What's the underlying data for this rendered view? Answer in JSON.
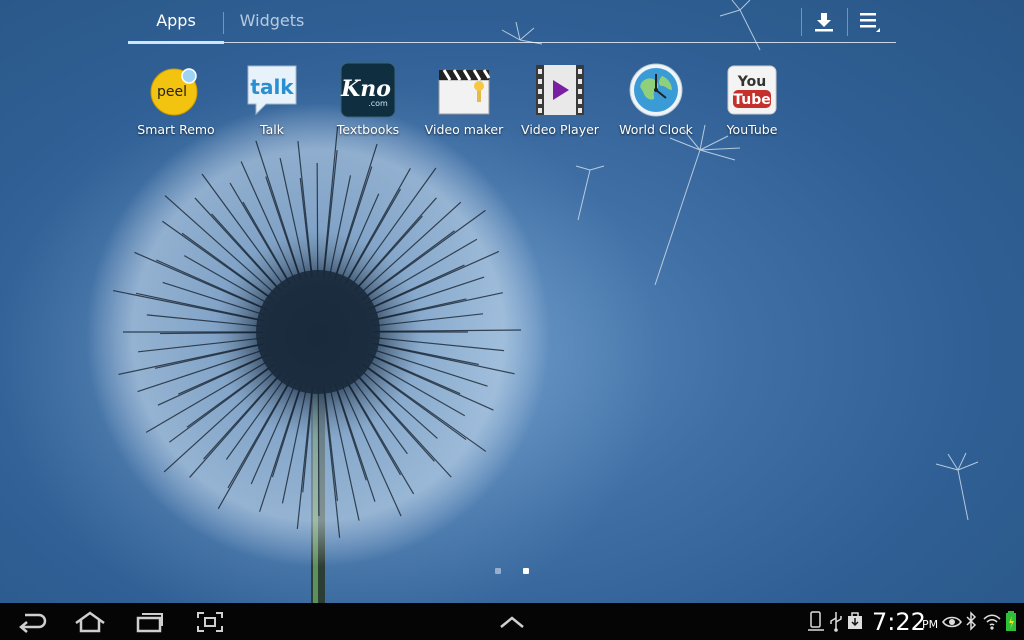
{
  "tabs": [
    {
      "label": "Apps",
      "selected": true
    },
    {
      "label": "Widgets",
      "selected": false
    }
  ],
  "toolbar": {
    "download_icon": "download-icon",
    "menu_icon": "menu-icon"
  },
  "apps": [
    {
      "label": "Smart Remo",
      "icon": "peel-smart-remote-icon"
    },
    {
      "label": "Talk",
      "icon": "talk-icon"
    },
    {
      "label": "Textbooks",
      "icon": "kno-textbooks-icon",
      "icon_text": "Kno",
      "icon_subtext": ".com"
    },
    {
      "label": "Video maker",
      "icon": "video-maker-icon"
    },
    {
      "label": "Video Player",
      "icon": "video-player-icon"
    },
    {
      "label": "World Clock",
      "icon": "world-clock-icon"
    },
    {
      "label": "YouTube",
      "icon": "youtube-icon",
      "icon_text_top": "You",
      "icon_text_bottom": "Tube"
    }
  ],
  "peel_text": "peel",
  "talk_text": "talk",
  "pager": {
    "count": 2,
    "current": 2
  },
  "navbar": {
    "buttons": [
      "back-icon",
      "home-icon",
      "recent-apps-icon",
      "screenshot-icon",
      "up-arrow-icon"
    ]
  },
  "status": {
    "time": "7:22",
    "ampm": "PM",
    "icons": [
      "phone-connected-icon",
      "usb-icon",
      "download-complete-icon",
      "smart-stay-eye-icon",
      "bluetooth-icon",
      "wifi-icon",
      "battery-charging-icon"
    ]
  },
  "colors": {
    "background": "#3b6a9e",
    "navbar": "#050505",
    "tab_underline": "#cfe4ff",
    "youtube_red": "#c4302b",
    "peel_yellow": "#f2c30f"
  }
}
